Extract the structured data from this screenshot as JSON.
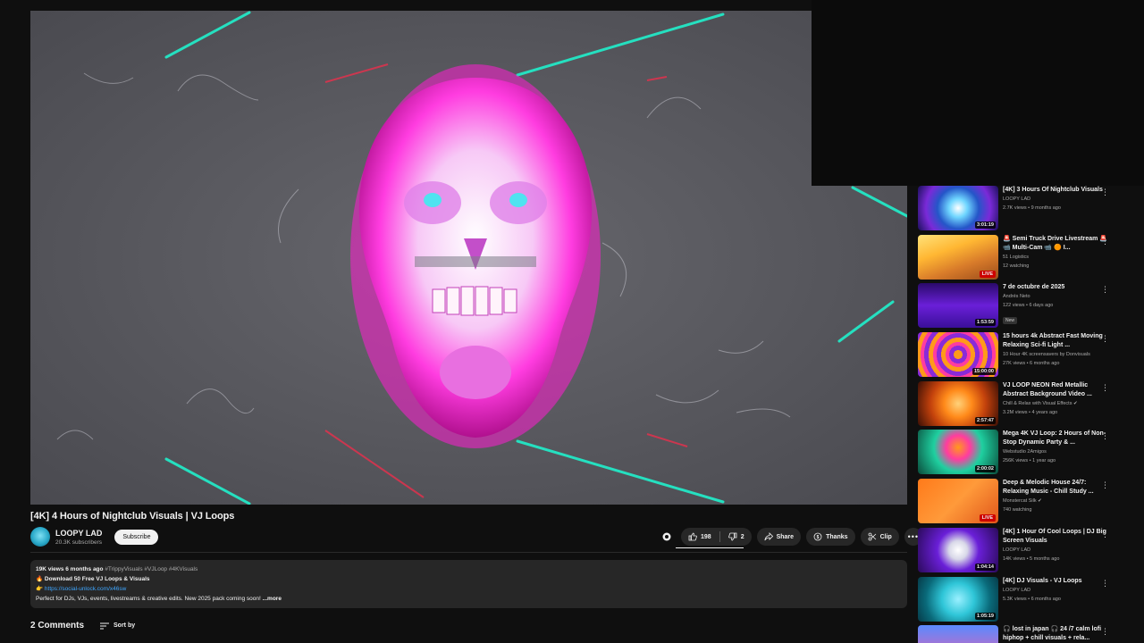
{
  "video": {
    "title": "[4K] 4 Hours of Nightclub Visuals | VJ Loops",
    "channel": "LOOPY LAD",
    "subscribers": "20.3K subscribers",
    "subscribe_label": "Subscribe"
  },
  "actions": {
    "likes": "198",
    "dislikes": "2",
    "share": "Share",
    "thanks": "Thanks",
    "clip": "Clip"
  },
  "description": {
    "views_date": "19K views  6 months ago",
    "tags": "#TrippyVisuals #VJLoop #4KVisuals",
    "line1": "Download 50 Free VJ Loops & Visuals",
    "link": "https://social-unlock.com/x46sw",
    "line3": "Perfect for DJs, VJs, events, livestreams & creative edits. New 2025 pack coming soon!",
    "more": "...more"
  },
  "comments": {
    "count": "2 Comments",
    "sort": "Sort by"
  },
  "recommendations": [
    {
      "title": "[4K] 3 Hours Of Nightclub Visuals",
      "channel": "LOOPY LAD",
      "meta": "2.7K views • 9 months ago",
      "duration": "3:01:19",
      "live": "",
      "badge": ""
    },
    {
      "title": "🚨 Semi Truck Drive Livestream 🚨 📹 Multi-Cam 📹 🟠 I...",
      "channel": "51 Logistics",
      "meta": "12 watching",
      "duration": "",
      "live": "LIVE",
      "badge": ""
    },
    {
      "title": "7 de octubre de 2025",
      "channel": "Andrés Neto",
      "meta": "122 views • 6 days ago",
      "duration": "1:53:59",
      "live": "",
      "badge": "New"
    },
    {
      "title": "15 hours 4k Abstract Fast Moving Relaxing Sci-fi Light ...",
      "channel": "10 Hour 4K screensavers by Donvisuals",
      "meta": "27K views • 6 months ago",
      "duration": "15:00:00",
      "live": "",
      "badge": ""
    },
    {
      "title": "VJ LOOP NEON Red Metallic Abstract Background Video ...",
      "channel": "Chill & Relax with Visual Effects ✔",
      "meta": "3.2M views • 4 years ago",
      "duration": "2:57:47",
      "live": "",
      "badge": ""
    },
    {
      "title": "Mega 4K VJ Loop: 2 Hours of Non-Stop Dynamic Party & ...",
      "channel": "Webstudio 2Amigos",
      "meta": "256K views • 1 year ago",
      "duration": "2:00:02",
      "live": "",
      "badge": ""
    },
    {
      "title": "Deep & Melodic House 24/7: Relaxing Music - Chill Study ...",
      "channel": "Monstercat Silk ✔",
      "meta": "740 watching",
      "duration": "",
      "live": "LIVE",
      "badge": ""
    },
    {
      "title": "[4K] 1 Hour Of Cool Loops | DJ Big Screen Visuals",
      "channel": "LOOPY LAD",
      "meta": "14K views • 5 months ago",
      "duration": "1:04:14",
      "live": "",
      "badge": ""
    },
    {
      "title": "[4K] DJ Visuals - VJ Loops",
      "channel": "LOOPY LAD",
      "meta": "5.3K views • 6 months ago",
      "duration": "1:05:19",
      "live": "",
      "badge": ""
    },
    {
      "title": "🎧 lost in japan 🎧 24 /7 calm lofi hiphop + chill visuals + rela...",
      "channel": "",
      "meta": "",
      "duration": "",
      "live": "",
      "badge": ""
    }
  ],
  "colors": {
    "background": "#0f0f0f",
    "pill": "#272727",
    "link": "#3ea6ff",
    "live": "#cc0000",
    "skull_magenta": "#ff3ce0",
    "lines_cyan": "#25e0c0"
  }
}
